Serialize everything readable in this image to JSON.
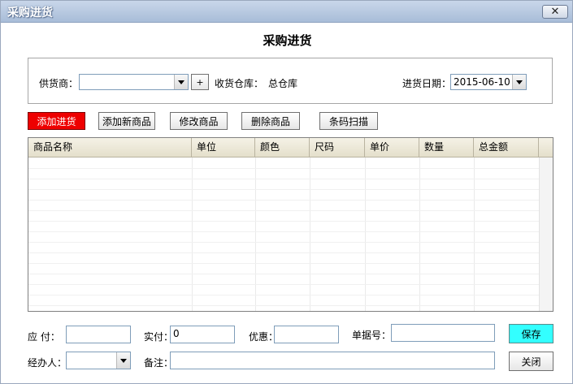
{
  "window": {
    "title": "采购进货",
    "close_glyph": "✕"
  },
  "heading": "采购进货",
  "filters": {
    "supplier_label": "供货商：",
    "supplier_value": "",
    "add_supplier_label": "+",
    "warehouse_label": "收货仓库：",
    "warehouse_value": "总仓库",
    "date_label": "进货日期：",
    "date_value": "2015-06-10"
  },
  "toolbar": {
    "add_purchase": "添加进货",
    "add_new_product": "添加新商品",
    "edit_product": "修改商品",
    "delete_product": "删除商品",
    "barcode_scan": "条码扫描"
  },
  "table": {
    "columns": [
      "商品名称",
      "单位",
      "颜色",
      "尺码",
      "单价",
      "数量",
      "总金额"
    ],
    "rows": []
  },
  "footer": {
    "payable_label": "应  付：",
    "payable_value": "",
    "paid_label": "实付：",
    "paid_value": "0",
    "discount_label": "优惠：",
    "discount_value": "",
    "doc_no_label": "单据号：",
    "doc_no_value": "",
    "save_label": "保存",
    "handler_label": "经办人：",
    "handler_value": "",
    "remark_label": "备注：",
    "remark_value": "",
    "close_label": "关闭"
  },
  "colors": {
    "add_purchase_bg": "#ee0000",
    "save_bg": "#33ffff",
    "title_bar": "#b8cbe4"
  },
  "icons": {
    "dropdown": "chevron-down-icon",
    "close": "close-icon"
  }
}
